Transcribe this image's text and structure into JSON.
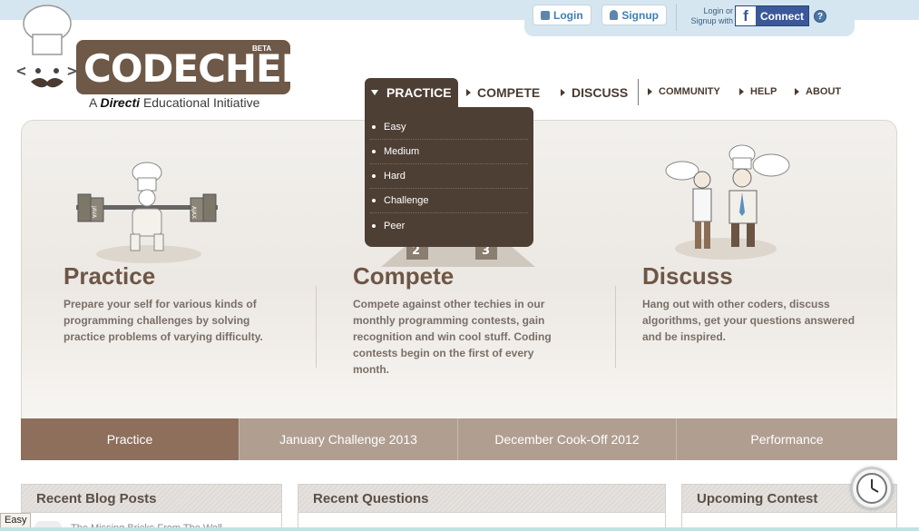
{
  "header": {
    "login_label": "Login",
    "signup_label": "Signup",
    "login_with_text": "Login or Signup with",
    "connect_label": "Connect",
    "facebook_letter": "f",
    "help_symbol": "?"
  },
  "logo": {
    "name": "CODECHEF",
    "beta": "BETA",
    "tagline_prefix": "A",
    "tagline_brand": "Directi",
    "tagline_suffix": "Educational Initiative",
    "brand_color": "#6e5847"
  },
  "nav": {
    "practice": "PRACTICE",
    "compete": "COMPETE",
    "discuss": "DISCUSS",
    "community": "COMMUNITY",
    "help": "HELP",
    "about": "ABOUT"
  },
  "dropdown": {
    "items": [
      "Easy",
      "Medium",
      "Hard",
      "Challenge",
      "Peer"
    ]
  },
  "features": {
    "practice": {
      "title": "Practice",
      "text": "Prepare your self for various kinds of programming challenges by solving practice problems of varying difficulty."
    },
    "compete": {
      "title": "Compete",
      "text": "Compete against other techies in our monthly programming contests, gain recognition and win cool stuff. Coding contests begin on the first of every month."
    },
    "discuss": {
      "title": "Discuss",
      "text": "Hang out with other coders, discuss algorithms, get your questions answered and be inspired."
    },
    "barbell_left": "JAVA",
    "barbell_right": "AJAX",
    "podium_left": "2",
    "podium_right": "3"
  },
  "tabs": [
    "Practice",
    "January Challenge 2013",
    "December Cook-Off 2012",
    "Performance"
  ],
  "boxes": {
    "blog": "Recent Blog Posts",
    "questions": "Recent Questions",
    "contest": "Upcoming Contest",
    "blog_peek": "The Missing Bricks From The Wall"
  },
  "status": {
    "easy": "Easy"
  },
  "colors": {
    "nav_active": "#4e3f35",
    "tab_active": "#8e6f5b",
    "tab_inactive": "#b09e91",
    "title": "#6d5646"
  }
}
